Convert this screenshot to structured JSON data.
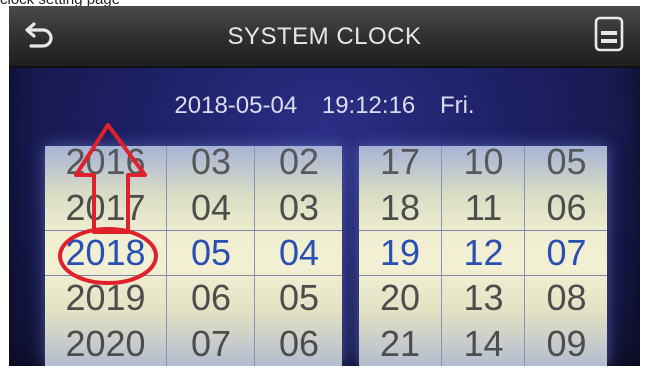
{
  "caption": "clock setting page",
  "header": {
    "title": "SYSTEM CLOCK",
    "back_icon": "back-arrow-icon",
    "save_icon": "save-icon"
  },
  "datetime": {
    "date": "2018-05-04",
    "time": "19:12:16",
    "weekday": "Fri."
  },
  "pickers": {
    "year": [
      "2016",
      "2017",
      "2018",
      "2019",
      "2020"
    ],
    "month": [
      "03",
      "04",
      "05",
      "06",
      "07"
    ],
    "day": [
      "02",
      "03",
      "04",
      "05",
      "06"
    ],
    "hour": [
      "17",
      "18",
      "19",
      "20",
      "21"
    ],
    "minute": [
      "10",
      "11",
      "12",
      "13",
      "14"
    ],
    "second": [
      "05",
      "06",
      "07",
      "08",
      "09"
    ],
    "selected_index": 2
  },
  "colors": {
    "screen_bg": "#1d1f63",
    "selected_text": "#2a4fb3",
    "annotation": "#e0202a"
  }
}
